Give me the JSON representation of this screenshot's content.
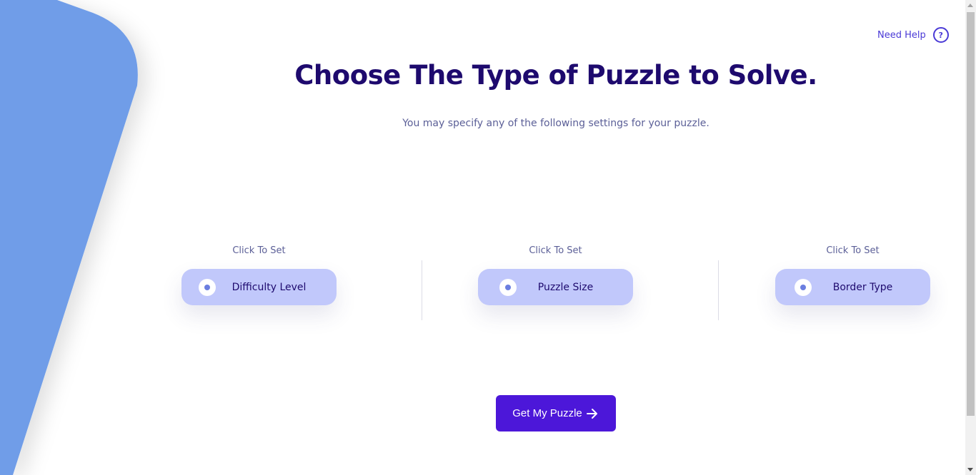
{
  "help": {
    "label": "Need Help",
    "icon": "question-circle-icon",
    "icon_glyph": "?"
  },
  "header": {
    "title": "Choose The Type of Puzzle to Solve.",
    "subtitle": "You may specify any of the following settings for your puzzle."
  },
  "options": [
    {
      "caption": "Click To Set",
      "label": "Difficulty Level"
    },
    {
      "caption": "Click To Set",
      "label": "Puzzle Size"
    },
    {
      "caption": "Click To Set",
      "label": "Border Type"
    }
  ],
  "cta": {
    "label": "Get My Puzzle",
    "icon": "arrow-right-icon"
  },
  "colors": {
    "accent": "#4c17d9",
    "title": "#1e0a6e",
    "option_bg": "#c1c8fb",
    "decor": "#6f9de8"
  }
}
